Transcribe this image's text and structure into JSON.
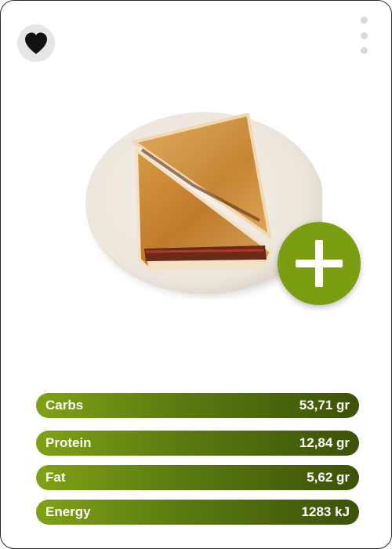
{
  "colors": {
    "accent": "#7a9d12",
    "bar_gradient_start": "#80a214",
    "bar_gradient_end": "#3c5208",
    "favorite_bg": "#e6e6e6",
    "menu_dots": "#d9d9d9"
  },
  "header": {
    "favorite_icon": "heart-icon",
    "menu_icon": "more-vertical-icon"
  },
  "food": {
    "image_alt": "sandwich-image",
    "name": "",
    "subtitle": ""
  },
  "actions": {
    "add_icon": "plus-icon"
  },
  "nutrients": [
    {
      "label": "Carbs",
      "value": "53,71 gr"
    },
    {
      "label": "Protein",
      "value": "12,84 gr"
    },
    {
      "label": "Fat",
      "value": "5,62 gr"
    },
    {
      "label": "Energy",
      "value": "1283 kJ"
    }
  ]
}
